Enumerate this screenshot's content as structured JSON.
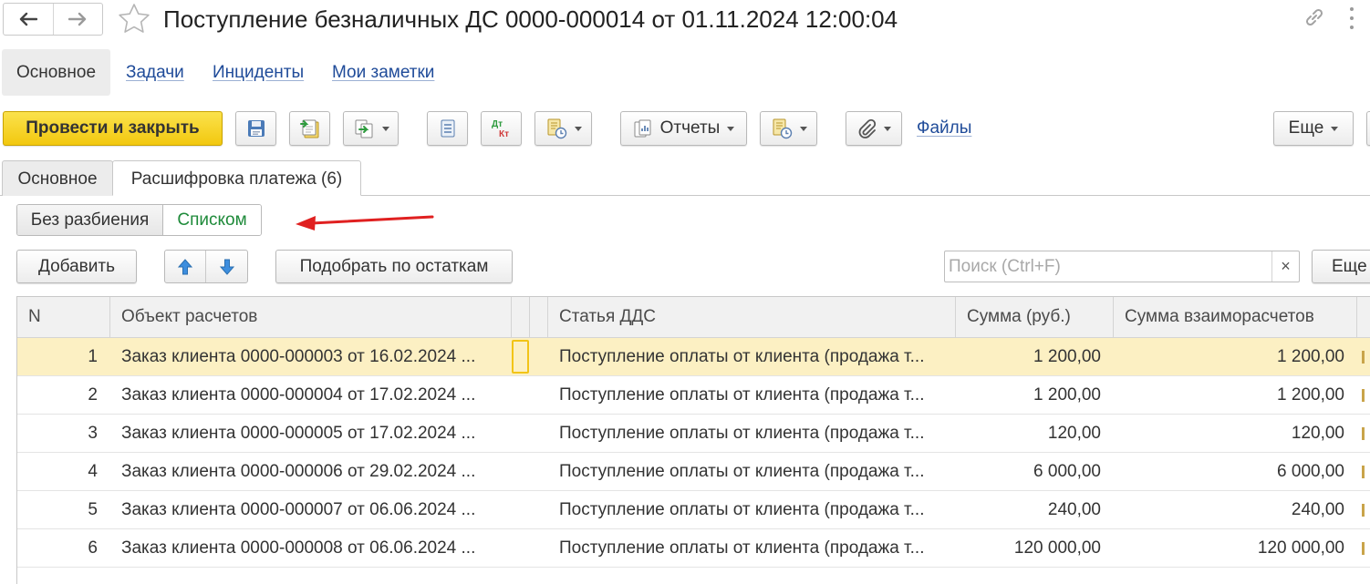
{
  "window": {
    "title": "Поступление безналичных ДС 0000-000014 от 01.11.2024 12:00:04",
    "icons": [
      "arrow-left-icon",
      "arrow-right-icon",
      "star-icon",
      "link-icon",
      "more-vertical-icon"
    ]
  },
  "sections": {
    "active": "Основное",
    "links": [
      "Задачи",
      "Инциденты",
      "Мои заметки"
    ]
  },
  "toolbar": {
    "post_close_label": "Провести и закрыть",
    "reports_label": "Отчеты",
    "files_label": "Файлы",
    "more_label": "Еще",
    "dt_kt_top": "Дт",
    "dt_kt_bottom": "Кт"
  },
  "tabs": {
    "main": "Основное",
    "breakdown": "Расшифровка платежа (6)"
  },
  "switch": {
    "option_1": "Без разбиения",
    "option_2": "Списком",
    "selected": "Списком",
    "selected_color": "#1e8a3a"
  },
  "table_toolbar": {
    "add_label": "Добавить",
    "pick_label": "Подобрать по остаткам",
    "more_label": "Еще",
    "search_placeholder": "Поиск (Ctrl+F)",
    "search_value": ""
  },
  "table": {
    "columns": [
      "N",
      "Объект расчетов",
      "Статья ДДС",
      "Сумма (руб.)",
      "Сумма взаиморасчетов"
    ],
    "rows": [
      {
        "n": "1",
        "object": "Заказ клиента 0000-000003 от 16.02.2024 ...",
        "article": "Поступление оплаты от клиента (продажа т...",
        "sum": "1 200,00",
        "settlement": "1 200,00"
      },
      {
        "n": "2",
        "object": "Заказ клиента 0000-000004 от 17.02.2024 ...",
        "article": "Поступление оплаты от клиента (продажа т...",
        "sum": "1 200,00",
        "settlement": "1 200,00"
      },
      {
        "n": "3",
        "object": "Заказ клиента 0000-000005 от 17.02.2024 ...",
        "article": "Поступление оплаты от клиента (продажа т...",
        "sum": "120,00",
        "settlement": "120,00"
      },
      {
        "n": "4",
        "object": "Заказ клиента 0000-000006 от 29.02.2024 ...",
        "article": "Поступление оплаты от клиента (продажа т...",
        "sum": "6 000,00",
        "settlement": "6 000,00"
      },
      {
        "n": "5",
        "object": "Заказ клиента 0000-000007 от 06.06.2024 ...",
        "article": "Поступление оплаты от клиента (продажа т...",
        "sum": "240,00",
        "settlement": "240,00"
      },
      {
        "n": "6",
        "object": "Заказ клиента 0000-000008 от 06.06.2024 ...",
        "article": "Поступление оплаты от клиента (продажа т...",
        "sum": "120 000,00",
        "settlement": "120 000,00"
      }
    ],
    "selected_row": 1,
    "selected_row_color": "#fcf0c3"
  },
  "annotation": {
    "arrow_color": "#e02020"
  }
}
